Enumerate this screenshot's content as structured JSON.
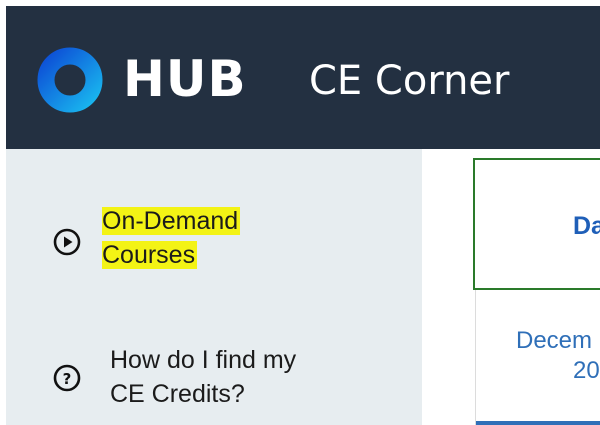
{
  "header": {
    "logo_text": "HUB",
    "app_name": "CE Corner",
    "bg_color": "#233041",
    "logo_ring_colors": [
      "#0d4fd6",
      "#19b7ef"
    ]
  },
  "sidebar": {
    "items": [
      {
        "label_line1": "On-Demand",
        "label_line2": "Courses",
        "icon": "play-circle-icon",
        "highlighted": true
      },
      {
        "label_line1": "How do I find my",
        "label_line2": "CE Credits?",
        "icon": "question-circle-icon",
        "highlighted": false
      }
    ],
    "highlight_color": "#f3f315"
  },
  "main": {
    "card_title": "Da",
    "date_line1": "Decem",
    "date_line2": "20"
  }
}
